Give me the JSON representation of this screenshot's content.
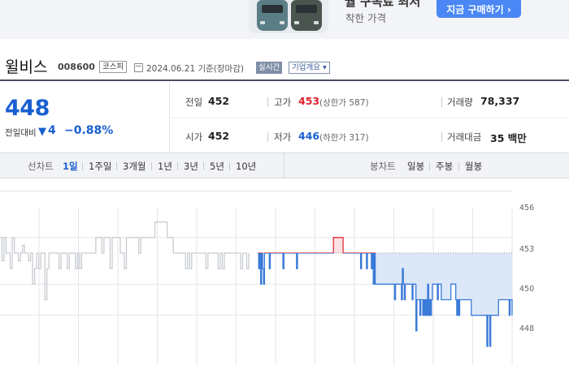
{
  "ad": {
    "headline": "월 구독료 최저",
    "subtext": "착한 가격",
    "button_label": "지금 구매하기 ›"
  },
  "stock": {
    "name": "윌비스",
    "code": "008600",
    "market": "코스피",
    "date_info": "2024.06.21  기준(장마감)",
    "realtime_label": "실시간",
    "company_label": "기업개요 ▾"
  },
  "summary": {
    "price": "448",
    "change_label": "전일대비",
    "change_arrow": "▼",
    "change": "4",
    "change_rate": "−0.88%",
    "prev_close_label": "전일",
    "prev_close": "452",
    "high_label": "고가",
    "high": "453",
    "upper_limit": "(상한가 587)",
    "volume_label": "거래량",
    "volume": "78,337",
    "open_label": "시가",
    "open": "452",
    "low_label": "저가",
    "low": "446",
    "lower_limit": "(하한가 317)",
    "amount_label": "거래대금",
    "amount": "35 백만"
  },
  "toolbar": {
    "line_label": "선차트",
    "line_periods": [
      "1일",
      "1주일",
      "3개월",
      "1년",
      "3년",
      "5년",
      "10년"
    ],
    "active_period": "1일",
    "candle_label": "봉차트",
    "candle_periods": [
      "일봉",
      "주봉",
      "월봉"
    ]
  },
  "chart_data": {
    "type": "line",
    "ylim": [
      444.8,
      456.8
    ],
    "y_ticks": [
      "456",
      "453",
      "450",
      "448"
    ],
    "reference_line": 452,
    "grid": true,
    "colors": {
      "prev_day": "#c8ccd2",
      "up": "#e0303a",
      "down": "#3a7ad8",
      "fill": "#dce8f8",
      "grid": "#e4e6ea"
    },
    "series": [
      {
        "values": [
          453,
          451.5,
          453,
          452,
          452,
          451,
          453,
          452,
          452,
          451.5,
          452,
          452.5,
          452,
          452,
          451.5,
          452,
          450,
          451,
          452,
          451,
          452,
          452,
          449,
          451,
          452,
          452,
          452,
          452,
          452,
          451,
          452,
          452,
          452,
          451,
          452,
          452,
          452,
          451,
          452,
          451,
          452,
          452,
          452,
          452,
          452,
          452,
          452,
          453,
          453,
          453,
          452,
          453,
          453,
          453,
          451,
          453,
          453,
          453,
          453,
          452,
          452,
          451,
          453,
          453,
          453,
          453,
          453,
          453,
          452,
          453,
          453,
          453,
          453,
          453,
          453,
          453,
          454,
          454,
          454,
          454,
          454,
          454,
          453,
          453,
          453,
          452,
          452,
          452,
          452,
          452,
          452,
          451,
          452,
          451,
          452,
          452,
          452,
          452,
          452,
          452,
          452,
          451,
          452,
          452,
          452,
          452,
          452,
          451,
          452,
          451,
          452,
          452,
          452,
          452,
          452,
          452,
          452,
          452,
          451,
          452,
          452,
          451,
          452
        ]
      },
      {
        "values": [
          452,
          451,
          452,
          450,
          452,
          451,
          450,
          452,
          452,
          452,
          452,
          452,
          451,
          452,
          452,
          452,
          452,
          452,
          452,
          452,
          452,
          452,
          452,
          452,
          452,
          452,
          451,
          452,
          452,
          452,
          452,
          452,
          452,
          452,
          452,
          452,
          452,
          452,
          452,
          452,
          451,
          452,
          452,
          452,
          452,
          452,
          452,
          452,
          452,
          452,
          452,
          452,
          452,
          452,
          452,
          452,
          452,
          452,
          452,
          452,
          452,
          452,
          452,
          452,
          452,
          452,
          452,
          452,
          452,
          452,
          452,
          452,
          452,
          452,
          452,
          452,
          452,
          452,
          453,
          453,
          453,
          453,
          453,
          453,
          453,
          453,
          453,
          453,
          452,
          452,
          452,
          452,
          452,
          452,
          452,
          452,
          452,
          452,
          452,
          452,
          452,
          452,
          452,
          452,
          452,
          452,
          451,
          452,
          452,
          452,
          452,
          452,
          451,
          452,
          452,
          452,
          452,
          451,
          452,
          450,
          452,
          450,
          450,
          450,
          450,
          450,
          450,
          450,
          450,
          450,
          450,
          450,
          450,
          450,
          450,
          450,
          450,
          450,
          450,
          450,
          450,
          449,
          450,
          450,
          450,
          450,
          450,
          450,
          449,
          451,
          450,
          449,
          450,
          450,
          450,
          450,
          450,
          450,
          450,
          449,
          450,
          450,
          450,
          447,
          449,
          449,
          449,
          448,
          449,
          449,
          448,
          449,
          448,
          449,
          448,
          450,
          448,
          449,
          448,
          449,
          450,
          450,
          450,
          450,
          450,
          449,
          450,
          450,
          450,
          449,
          449,
          449,
          449,
          449,
          449,
          449,
          449,
          449,
          449,
          450,
          450,
          450,
          450,
          450,
          449,
          448,
          449,
          448,
          449,
          449,
          449,
          449,
          449,
          449,
          449,
          449,
          449,
          449,
          449,
          449,
          448,
          448,
          448,
          448,
          448,
          448,
          448,
          448,
          448,
          448,
          448,
          448,
          448,
          448,
          448,
          448,
          446,
          448,
          448,
          446,
          448,
          448,
          448,
          448,
          448,
          448,
          448,
          448,
          449,
          449,
          449,
          449,
          449,
          449,
          449,
          449,
          449,
          449,
          449,
          448,
          449,
          449,
          448
        ]
      }
    ]
  }
}
